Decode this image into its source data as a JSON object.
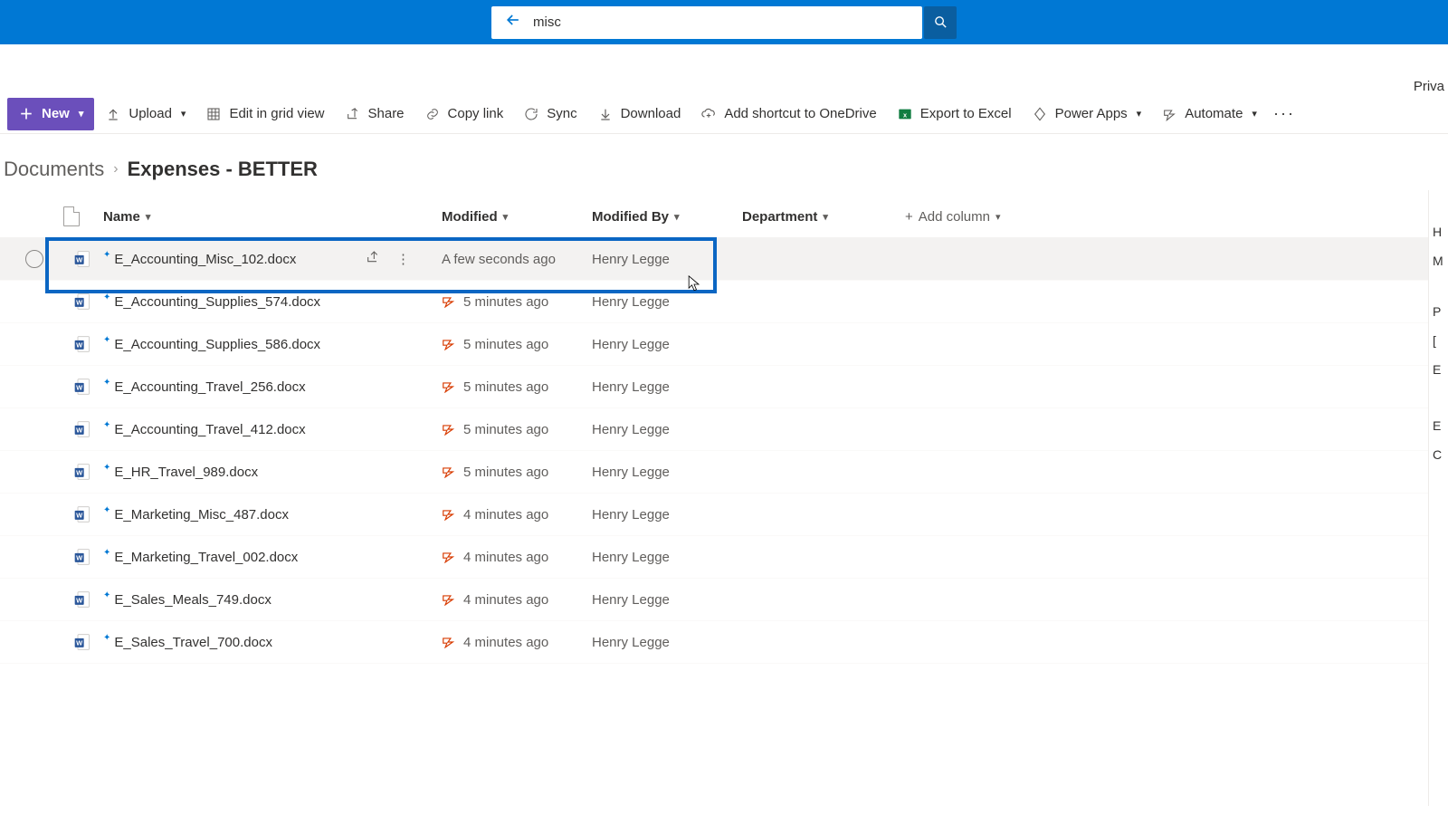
{
  "search": {
    "value": "misc"
  },
  "header_right": "Priva",
  "commands": {
    "new": "New",
    "upload": "Upload",
    "edit_grid": "Edit in grid view",
    "share": "Share",
    "copy_link": "Copy link",
    "sync": "Sync",
    "download": "Download",
    "add_shortcut": "Add shortcut to OneDrive",
    "export_excel": "Export to Excel",
    "power_apps": "Power Apps",
    "automate": "Automate"
  },
  "breadcrumb": {
    "root": "Documents",
    "current": "Expenses - BETTER"
  },
  "columns": {
    "name": "Name",
    "modified": "Modified",
    "modified_by": "Modified By",
    "department": "Department",
    "add": "Add column"
  },
  "rows": [
    {
      "name": "E_Accounting_Misc_102.docx",
      "modified": "A few seconds ago",
      "by": "Henry Legge",
      "selected": true,
      "flow": false
    },
    {
      "name": "E_Accounting_Supplies_574.docx",
      "modified": "5 minutes ago",
      "by": "Henry Legge",
      "selected": false,
      "flow": true
    },
    {
      "name": "E_Accounting_Supplies_586.docx",
      "modified": "5 minutes ago",
      "by": "Henry Legge",
      "selected": false,
      "flow": true
    },
    {
      "name": "E_Accounting_Travel_256.docx",
      "modified": "5 minutes ago",
      "by": "Henry Legge",
      "selected": false,
      "flow": true
    },
    {
      "name": "E_Accounting_Travel_412.docx",
      "modified": "5 minutes ago",
      "by": "Henry Legge",
      "selected": false,
      "flow": true
    },
    {
      "name": "E_HR_Travel_989.docx",
      "modified": "5 minutes ago",
      "by": "Henry Legge",
      "selected": false,
      "flow": true
    },
    {
      "name": "E_Marketing_Misc_487.docx",
      "modified": "4 minutes ago",
      "by": "Henry Legge",
      "selected": false,
      "flow": true
    },
    {
      "name": "E_Marketing_Travel_002.docx",
      "modified": "4 minutes ago",
      "by": "Henry Legge",
      "selected": false,
      "flow": true
    },
    {
      "name": "E_Sales_Meals_749.docx",
      "modified": "4 minutes ago",
      "by": "Henry Legge",
      "selected": false,
      "flow": true
    },
    {
      "name": "E_Sales_Travel_700.docx",
      "modified": "4 minutes ago",
      "by": "Henry Legge",
      "selected": false,
      "flow": true
    }
  ]
}
